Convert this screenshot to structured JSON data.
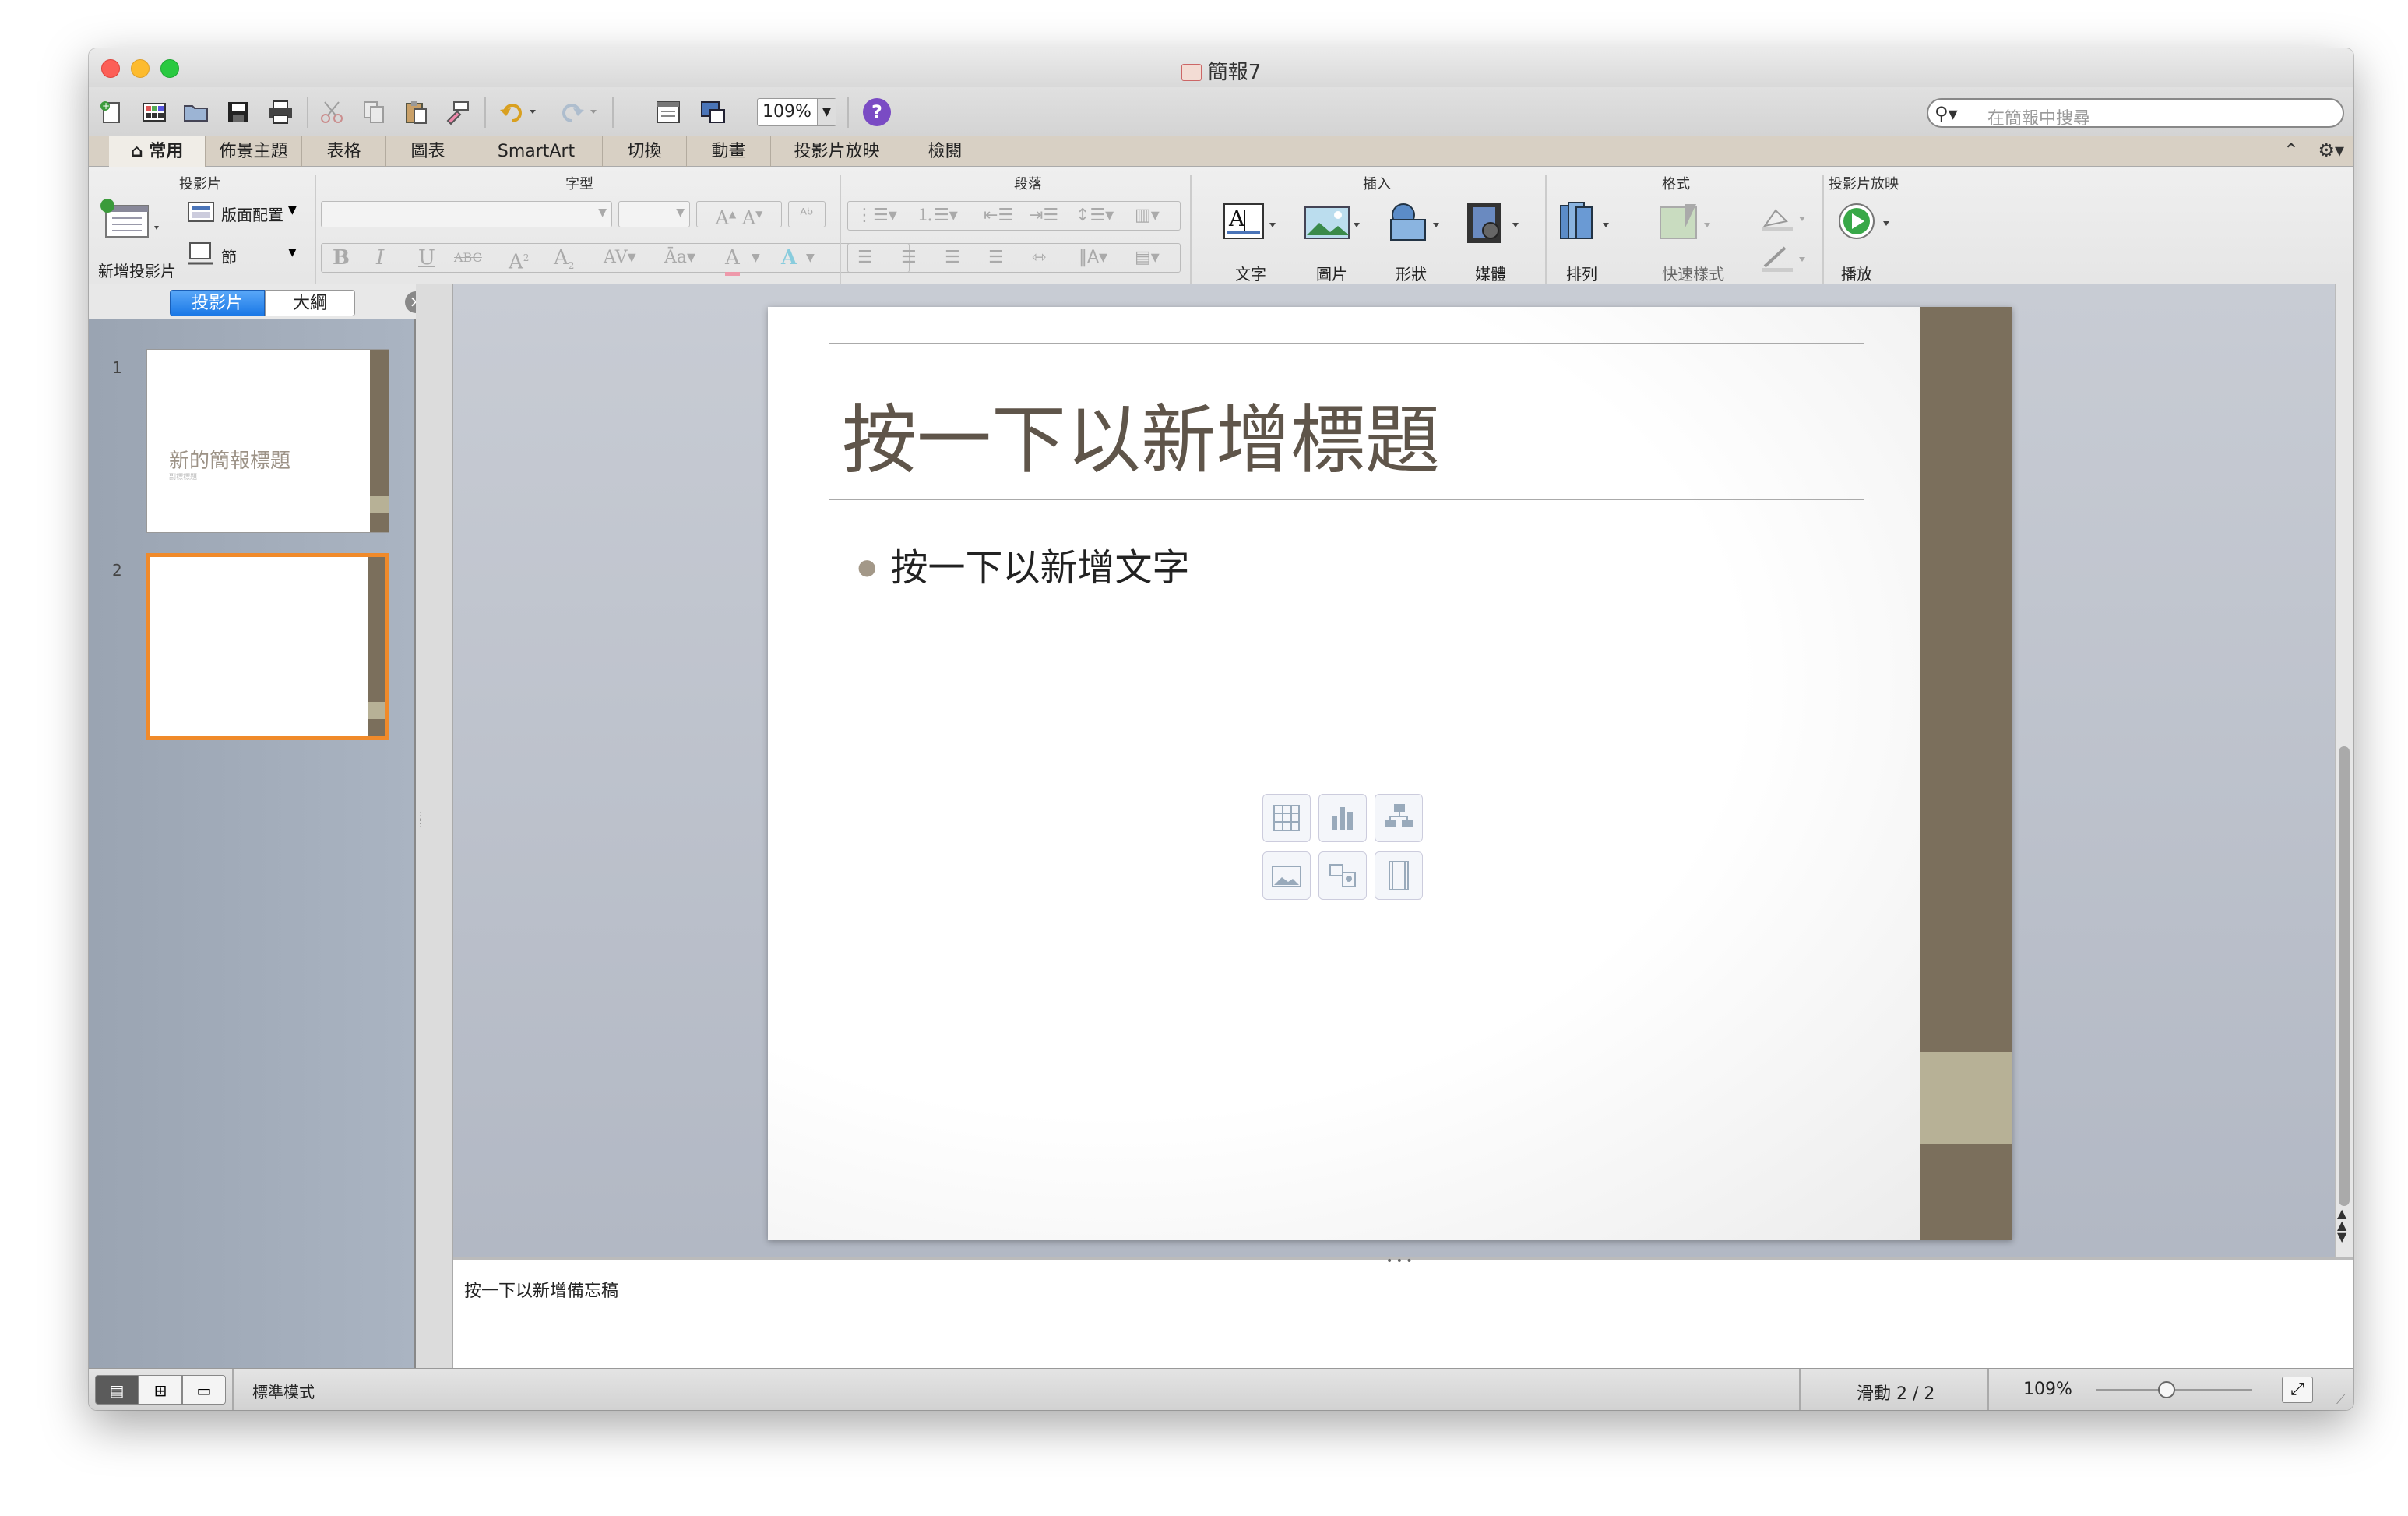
{
  "window": {
    "title": "簡報7"
  },
  "toolbar": {
    "zoom": "109%",
    "search_placeholder": "在簡報中搜尋"
  },
  "tabs": [
    {
      "label": "常用",
      "active": true
    },
    {
      "label": "佈景主題"
    },
    {
      "label": "表格"
    },
    {
      "label": "圖表"
    },
    {
      "label": "SmartArt"
    },
    {
      "label": "切換"
    },
    {
      "label": "動畫"
    },
    {
      "label": "投影片放映"
    },
    {
      "label": "檢閱"
    }
  ],
  "ribbon": {
    "groups": {
      "slides": "投影片",
      "font": "字型",
      "paragraph": "段落",
      "insert": "插入",
      "format": "格式",
      "slideshow": "投影片放映"
    },
    "new_slide": "新增投影片",
    "layout": "版面配置",
    "section": "節",
    "text": "文字",
    "picture": "圖片",
    "shape": "形狀",
    "media": "媒體",
    "arrange": "排列",
    "quick_styles": "快速樣式",
    "play": "播放"
  },
  "left_panel": {
    "tab_slides": "投影片",
    "tab_outline": "大綱",
    "thumbnails": [
      {
        "number": "1",
        "title": "新的簡報標題",
        "subtitle": "副標標題"
      },
      {
        "number": "2",
        "selected": true
      }
    ]
  },
  "slide": {
    "title_placeholder": "按一下以新增標題",
    "body_placeholder": "按一下以新增文字",
    "accent_color": "#7b6f5c",
    "accent_light": "#b7b196"
  },
  "notes": {
    "placeholder": "按一下以新增備忘稿"
  },
  "status": {
    "view_mode": "標準模式",
    "slide_position": "滑動 2 / 2",
    "zoom": "109%",
    "zoom_level": 0.45
  }
}
